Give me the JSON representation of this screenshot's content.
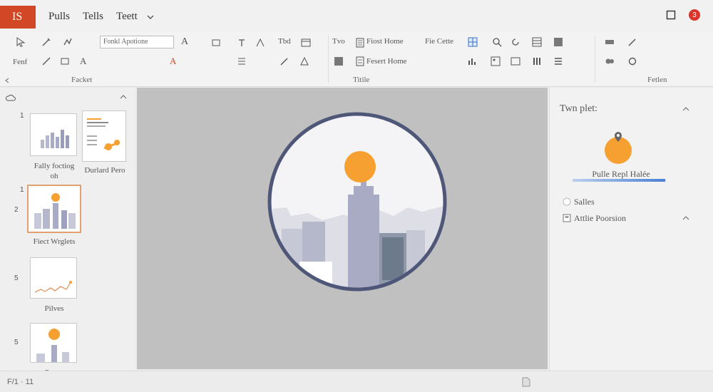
{
  "app": {
    "badge": "IS"
  },
  "menu": [
    "Pulls",
    "Tells",
    "Teett"
  ],
  "window": {
    "notification_count": "3"
  },
  "ribbon": {
    "font_name": "Fonkl Apotione",
    "row1_label1": "Tvo",
    "row1_label2": "Fiost Home",
    "row1_label3": "Fie Cette",
    "row2_label1": "Fenf",
    "row2_label2": "Fesert Home",
    "format_label": "Tbd",
    "groups": {
      "left": "Facket",
      "middle": "Titile",
      "right": "Fetlen"
    }
  },
  "slides": [
    {
      "num": "1",
      "caption": "Fally foctiog",
      "caption2": "oh",
      "type": "chart"
    },
    {
      "num": "",
      "caption": "Durlard Pero",
      "type": "doc"
    },
    {
      "num": "2",
      "caption": "Fiect Wrglets",
      "type": "city",
      "top_num": "1"
    },
    {
      "num": "5",
      "caption": "Pilves",
      "type": "line"
    },
    {
      "num": "5",
      "caption": "Pytter",
      "type": "city"
    }
  ],
  "panel": {
    "title": "Twn plet:",
    "caption": "Pulle Repl Halée",
    "option1": "Salles",
    "option2": "Attlie Poorsion"
  },
  "status": {
    "slide_counter": "F/1 · 11"
  },
  "colors": {
    "accent": "#d24726",
    "sun": "#f5a030",
    "frame": "#4f5778",
    "building": "#a9abc4"
  }
}
